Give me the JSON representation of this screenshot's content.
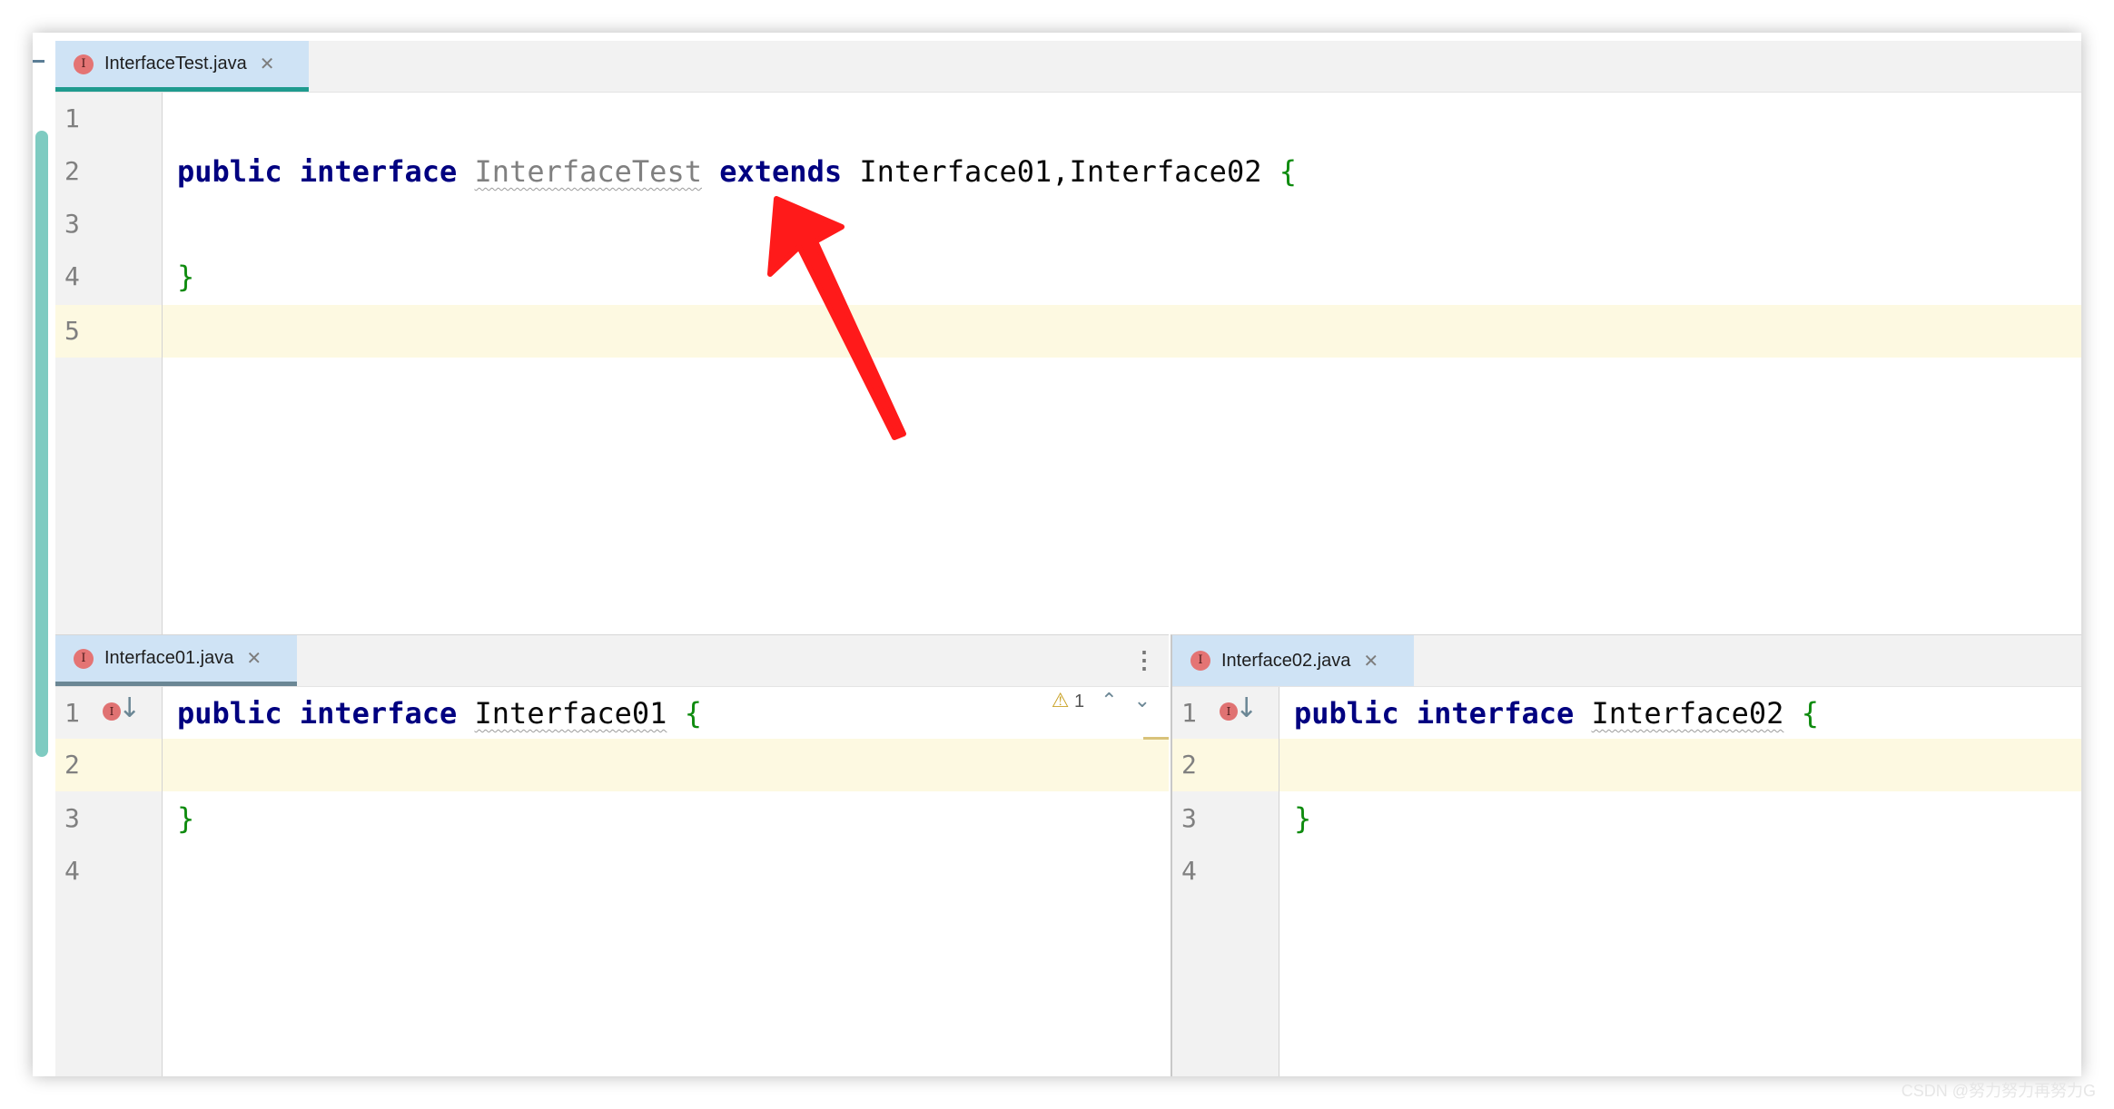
{
  "top_editor": {
    "tab": {
      "label": "InterfaceTest.java",
      "icon": "interface-file-icon"
    },
    "line_numbers": [
      "1",
      "2",
      "3",
      "4",
      "5"
    ],
    "code": {
      "line2": {
        "kw_public": "public",
        "kw_interface": "interface",
        "name": "InterfaceTest",
        "kw_extends": "extends",
        "parents": "Interface01,Interface02",
        "open_brace": "{"
      },
      "line4": {
        "close_brace": "}"
      }
    }
  },
  "left_editor": {
    "tab": {
      "label": "Interface01.java",
      "icon": "interface-file-icon"
    },
    "line_numbers": [
      "1",
      "2",
      "3",
      "4"
    ],
    "code": {
      "kw_public": "public",
      "kw_interface": "interface",
      "name": "Interface01",
      "open_brace": "{",
      "close_brace": "}"
    },
    "inspection": {
      "warning_count": "1",
      "icon": "warning-icon"
    }
  },
  "right_editor": {
    "tab": {
      "label": "Interface02.java",
      "icon": "interface-file-icon"
    },
    "line_numbers": [
      "1",
      "2",
      "3",
      "4"
    ],
    "code": {
      "kw_public": "public",
      "kw_interface": "interface",
      "name": "Interface02",
      "open_brace": "{",
      "close_brace": "}"
    }
  },
  "colors": {
    "keyword": "#000080",
    "brace": "#0f8b0f",
    "active_tab": "#cfe3f5",
    "caret_row": "#fdf9e1",
    "annotation_arrow": "#ff1a1a"
  },
  "watermark": "CSDN @努力努力再努力G"
}
